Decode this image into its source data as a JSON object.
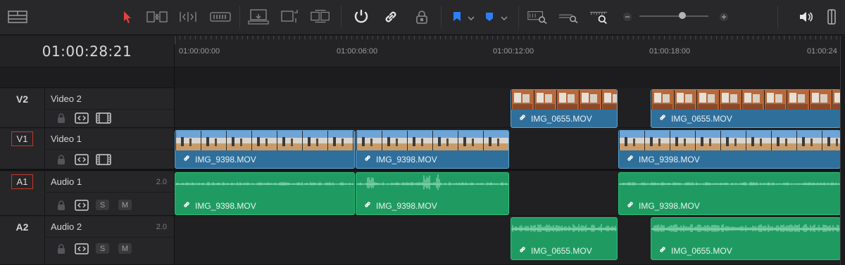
{
  "toolbar": {
    "icons": [
      "layout-icon",
      "selection-arrow-icon",
      "trim-edit-icon",
      "dynamic-trim-icon",
      "blade-icon",
      "insert-clip-icon",
      "overwrite-clip-icon",
      "replace-clip-icon",
      "snapping-icon",
      "linked-selection-icon",
      "position-lock-icon",
      "flag-icon",
      "marker-icon",
      "zoom-full-icon",
      "zoom-detail-icon",
      "zoom-custom-icon",
      "zoom-out-icon",
      "zoom-in-icon",
      "audio-volume-icon",
      "panel-toggle-icon"
    ],
    "zoom_level": 0.62,
    "colors": {
      "flag": "#2d7ff9",
      "marker": "#2d7ff9",
      "active_tool": "#e0433f"
    }
  },
  "timecode": "01:00:28:21",
  "ruler": {
    "labels": [
      "01:00:00:00",
      "01:00:06:00",
      "01:00:12:00",
      "01:00:18:00",
      "01:00:24"
    ]
  },
  "tracks": {
    "v2": {
      "id": "V2",
      "name": "Video 2"
    },
    "v1": {
      "id": "V1",
      "name": "Video 1"
    },
    "a1": {
      "id": "A1",
      "name": "Audio 1",
      "channels": "2.0",
      "solo": "S",
      "mute": "M"
    },
    "a2": {
      "id": "A2",
      "name": "Audio 2",
      "channels": "2.0",
      "solo": "S",
      "mute": "M"
    }
  },
  "clips": {
    "v2_1": "IMG_0655.MOV",
    "v2_2": "IMG_0655.MOV",
    "v1_1": "IMG_9398.MOV",
    "v1_2": "IMG_9398.MOV",
    "v1_3": "IMG_9398.MOV",
    "a1_1": "IMG_9398.MOV",
    "a1_2": "IMG_9398.MOV",
    "a1_3": "IMG_9398.MOV",
    "a2_1": "IMG_0655.MOV",
    "a2_2": "IMG_0655.MOV"
  },
  "colors": {
    "video_clip": "#2f6f9c",
    "audio_clip": "#1f9b62",
    "armed_track_border": "#c0392b"
  }
}
